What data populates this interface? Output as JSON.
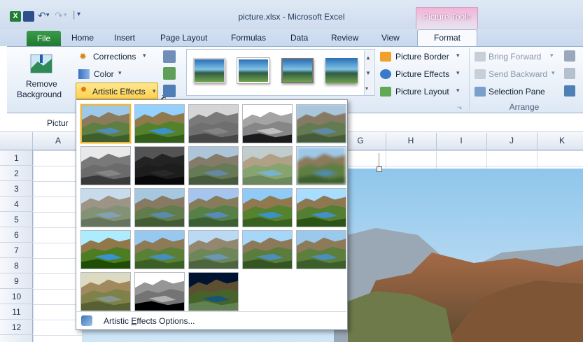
{
  "window": {
    "title": "picture.xlsx - Microsoft Excel",
    "context_tab_group": "Picture Tools"
  },
  "tabs": {
    "file": "File",
    "items": [
      "Home",
      "Insert",
      "Page Layout",
      "Formulas",
      "Data",
      "Review",
      "View"
    ],
    "format": "Format"
  },
  "ribbon": {
    "remove_background_line1": "Remove",
    "remove_background_line2": "Background",
    "corrections": "Corrections",
    "color": "Color",
    "artistic_effects": "Artistic Effects",
    "picture_border": "Picture Border",
    "picture_effects": "Picture Effects",
    "picture_layout": "Picture Layout",
    "bring_forward": "Bring Forward",
    "send_backward": "Send Backward",
    "selection_pane": "Selection Pane",
    "arrange_group": "Arrange"
  },
  "formula_bar": {
    "name_box_partial": "Pictur"
  },
  "sheet": {
    "columns": [
      "A",
      "G",
      "H",
      "I",
      "J",
      "K"
    ],
    "rows": [
      "1",
      "2",
      "3",
      "4",
      "5",
      "6",
      "7",
      "8",
      "9",
      "10",
      "11",
      "12"
    ]
  },
  "artistic_effects_menu": {
    "selected_index": 0,
    "effect_count": 23,
    "options_label_prefix": "Artistic ",
    "options_label_mnemonic": "E",
    "options_label_suffix": "ffects Options..."
  },
  "colors": {
    "accent_selected": "#e8b640",
    "file_tab": "#2a8a3e",
    "picture_tools": "#e9a3cc",
    "ribbon_blue": "#dde8f5"
  },
  "icons": [
    "excel-icon",
    "save-icon",
    "undo-icon",
    "redo-icon",
    "corrections-icon",
    "color-icon",
    "artistic-effects-icon",
    "picture-border-icon",
    "picture-effects-icon",
    "picture-layout-icon",
    "bring-forward-icon",
    "send-backward-icon",
    "selection-pane-icon",
    "mouse-cursor-icon",
    "artistic-options-icon"
  ]
}
